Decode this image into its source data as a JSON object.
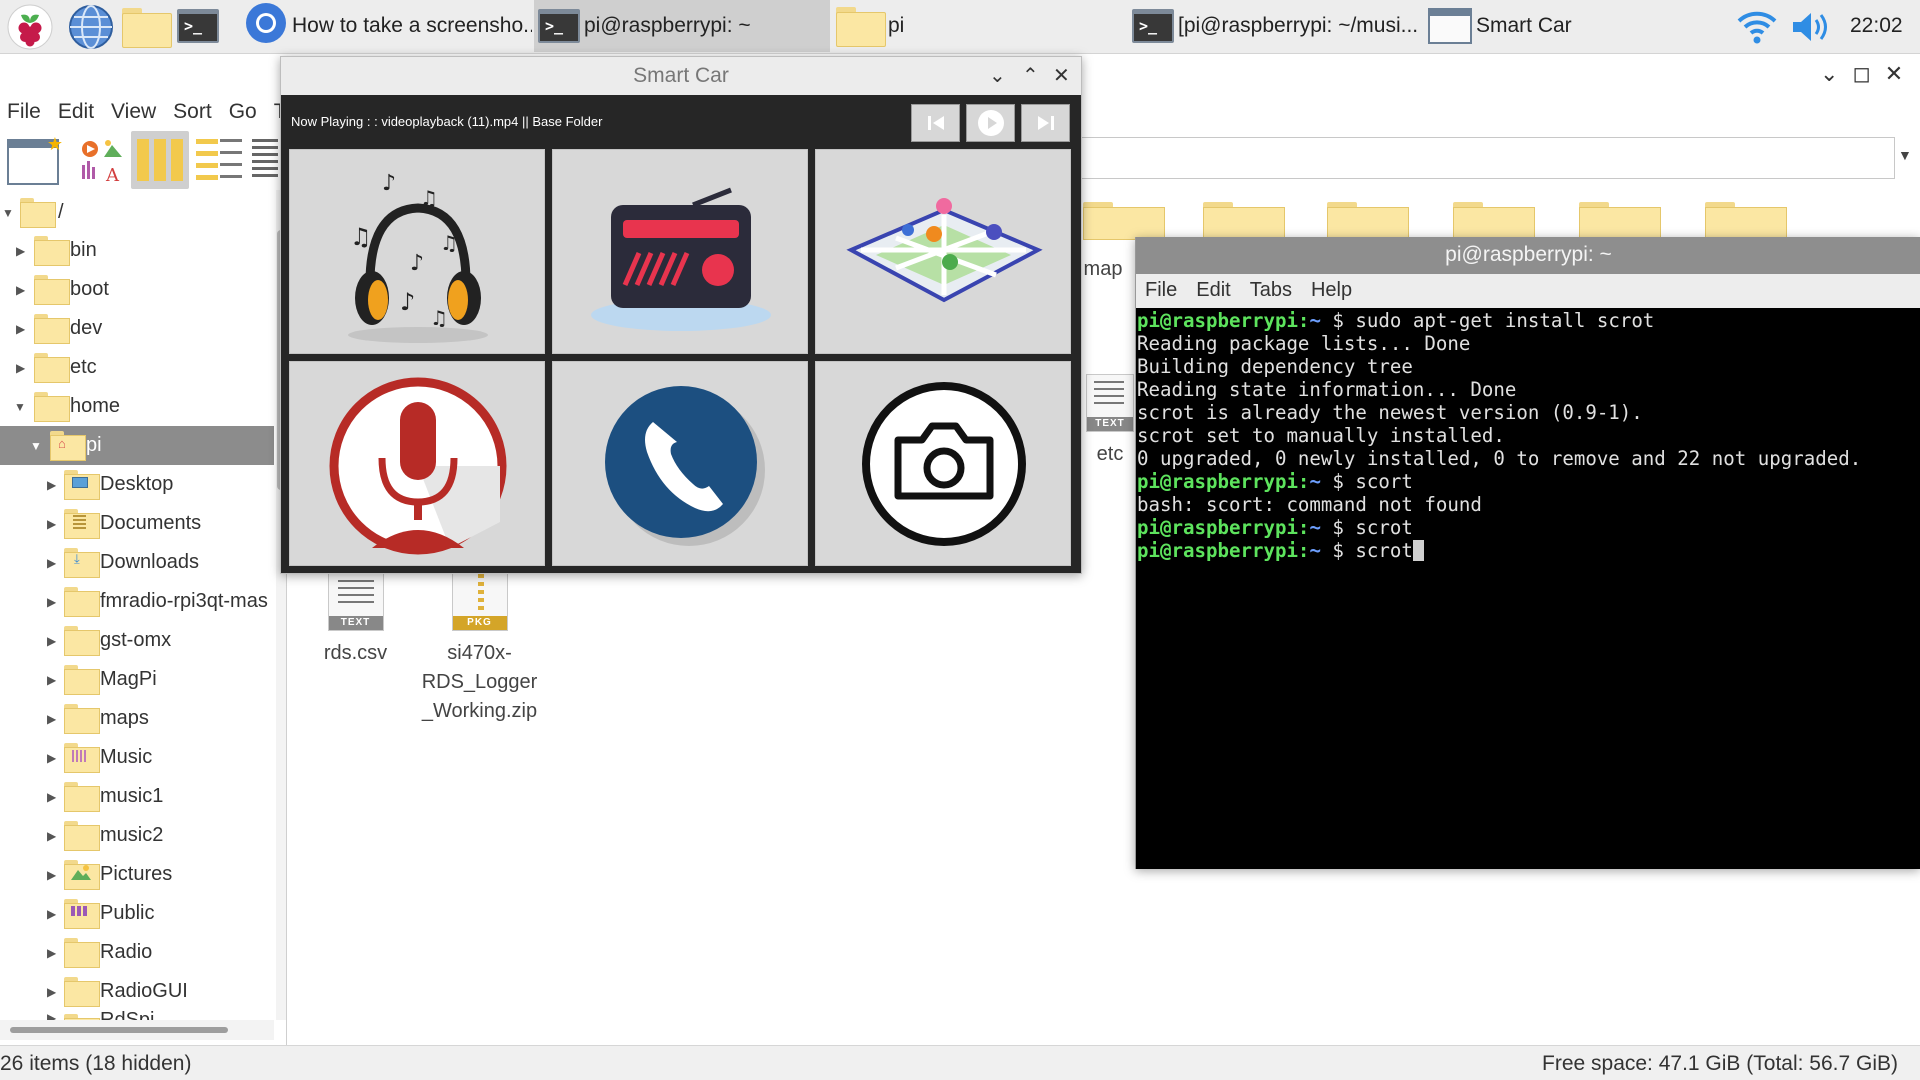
{
  "taskbar": {
    "tasks": [
      {
        "label": "How to take a screensho..."
      },
      {
        "label": "pi@raspberrypi: ~"
      },
      {
        "label": "pi"
      },
      {
        "label": "[pi@raspberrypi: ~/musi..."
      },
      {
        "label": "Smart Car"
      }
    ],
    "clock": "22:02"
  },
  "file_manager": {
    "menu": [
      "File",
      "Edit",
      "View",
      "Sort",
      "Go",
      "To"
    ],
    "tree": [
      {
        "label": "/"
      },
      {
        "label": "bin"
      },
      {
        "label": "boot"
      },
      {
        "label": "dev"
      },
      {
        "label": "etc"
      },
      {
        "label": "home"
      },
      {
        "label": "pi"
      },
      {
        "label": "Desktop"
      },
      {
        "label": "Documents"
      },
      {
        "label": "Downloads"
      },
      {
        "label": "fmradio-rpi3qt-mas"
      },
      {
        "label": "gst-omx"
      },
      {
        "label": "MagPi"
      },
      {
        "label": "maps"
      },
      {
        "label": "Music"
      },
      {
        "label": "music1"
      },
      {
        "label": "music2"
      },
      {
        "label": "Pictures"
      },
      {
        "label": "Public"
      },
      {
        "label": "Radio"
      },
      {
        "label": "RadioGUI"
      },
      {
        "label": "RdSpi"
      }
    ],
    "files": [
      {
        "name": "rds.csv",
        "tag": "TEXT"
      },
      {
        "name": "si470x-RDS_Logger_Working.zip",
        "tag": "PKG"
      },
      {
        "name": "etc",
        "tag": "TEXT"
      },
      {
        "name": "map",
        "tag": ""
      }
    ],
    "file_name_lines": {
      "zip_line1": "si470x-",
      "zip_line2": "RDS_Logger",
      "zip_line3": "_Working.zip"
    },
    "status_left": "26 items (18 hidden)",
    "status_right": "Free space: 47.1 GiB (Total: 56.7 GiB)"
  },
  "smart_car": {
    "title": "Smart Car",
    "now_playing": "Now Playing : : videoplayback (11).mp4 || Base Folder",
    "tiles": [
      "music",
      "radio",
      "map",
      "microphone",
      "phone",
      "camera"
    ]
  },
  "terminal": {
    "title": "pi@raspberrypi: ~",
    "menu": [
      "File",
      "Edit",
      "Tabs",
      "Help"
    ],
    "prompt_user": "pi@raspberrypi",
    "prompt_sep": ":",
    "prompt_path": "~",
    "prompt_dollar": " $ ",
    "lines": [
      {
        "cmd": "sudo apt-get install scrot"
      },
      {
        "out": "Reading package lists... Done"
      },
      {
        "out": "Building dependency tree"
      },
      {
        "out": "Reading state information... Done"
      },
      {
        "out": "scrot is already the newest version (0.9-1)."
      },
      {
        "out": "scrot set to manually installed."
      },
      {
        "out": "0 upgraded, 0 newly installed, 0 to remove and 22 not upgraded."
      },
      {
        "cmd": "scort"
      },
      {
        "out": "bash: scort: command not found"
      },
      {
        "cmd": "scrot"
      },
      {
        "cmd": "scrot",
        "cursor": true
      }
    ]
  },
  "colors": {
    "prompt_green": "#5de35d",
    "prompt_blue": "#6ea0ff",
    "selection_gray": "#8c8c8c",
    "folder_yellow": "#fbe7a3"
  }
}
